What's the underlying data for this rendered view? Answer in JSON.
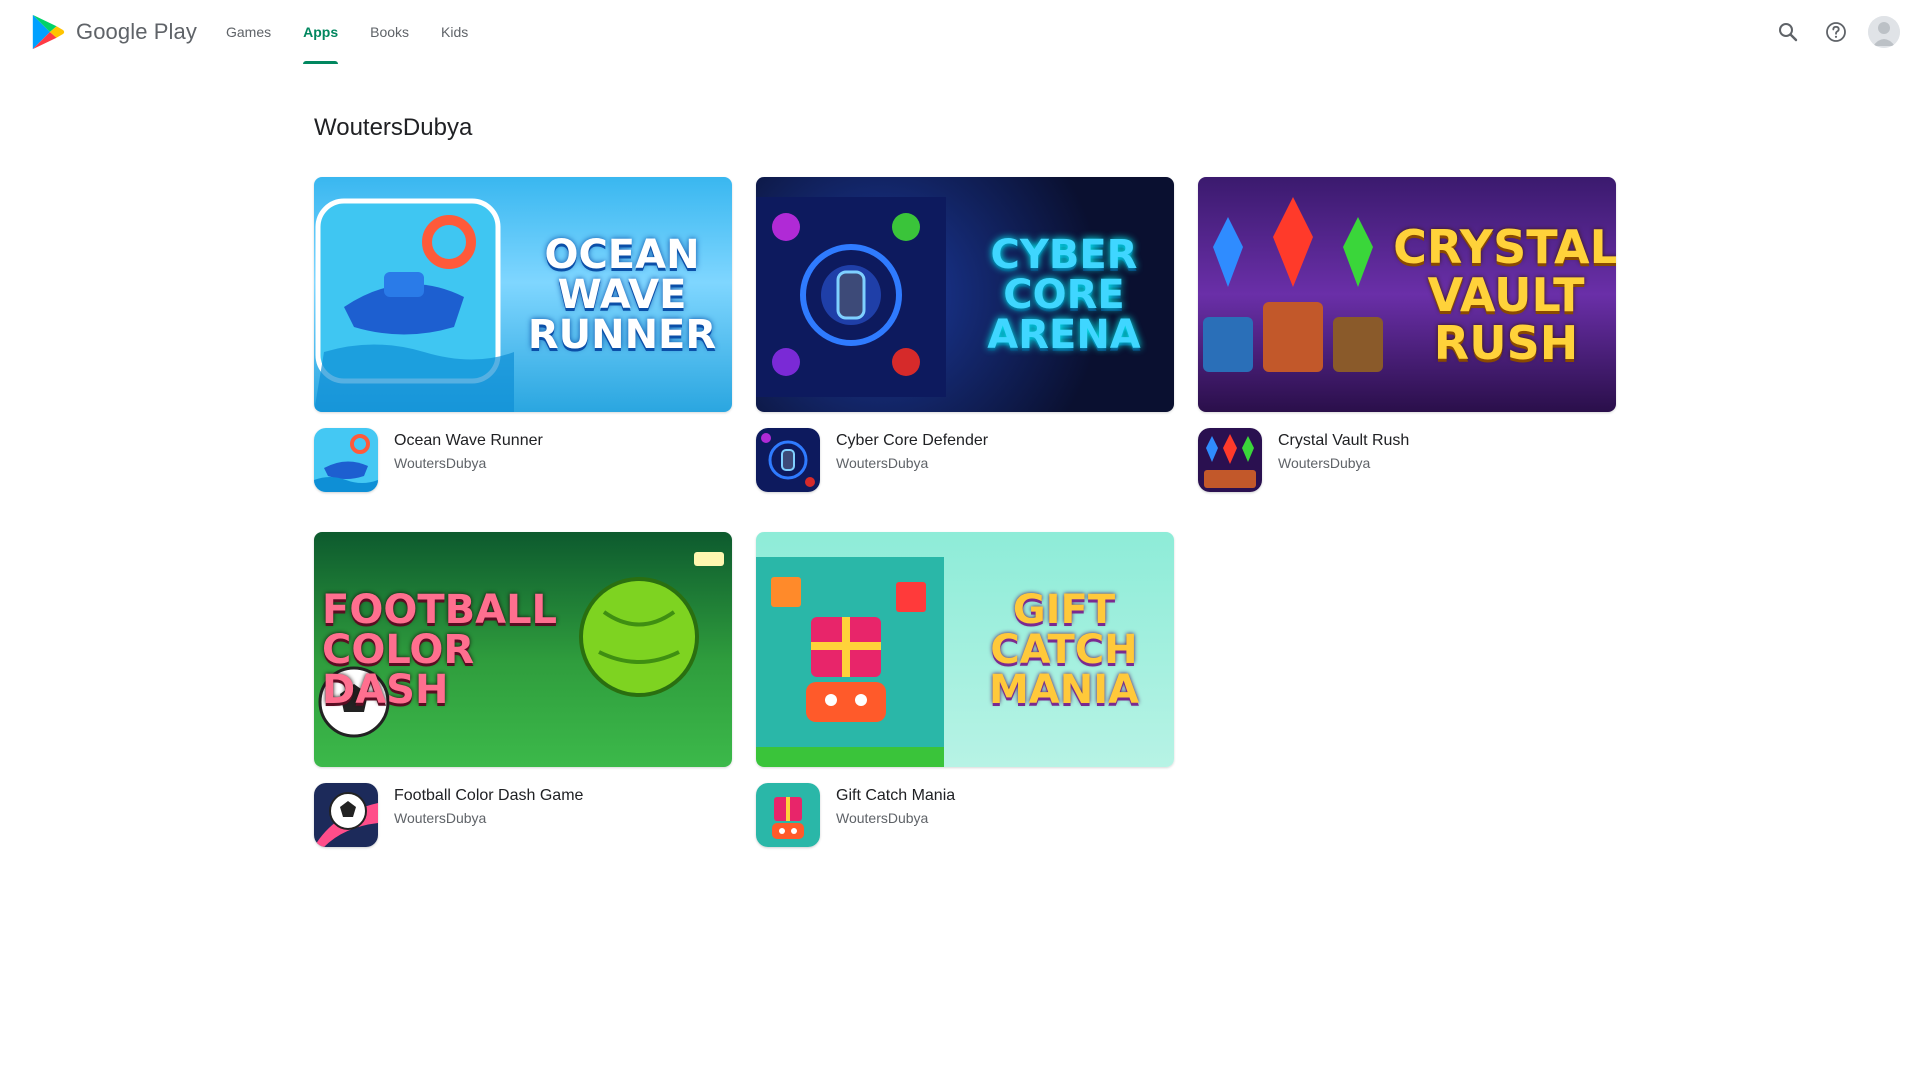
{
  "header": {
    "brand_label": "Google Play",
    "nav": [
      {
        "label": "Games",
        "active": false
      },
      {
        "label": "Apps",
        "active": true
      },
      {
        "label": "Books",
        "active": false
      },
      {
        "label": "Kids",
        "active": false
      }
    ],
    "icons": [
      "search-icon",
      "help-icon",
      "account-avatar"
    ],
    "accent_color": "#01875f"
  },
  "developer": {
    "name": "WoutersDubya"
  },
  "apps": [
    {
      "name": "Ocean Wave Runner",
      "developer": "WoutersDubya",
      "banner_title": [
        "OCEAN",
        "WAVE",
        "RUNNER"
      ]
    },
    {
      "name": "Cyber Core Defender",
      "developer": "WoutersDubya",
      "banner_title": [
        "CYBER",
        "CORE",
        "ARENA"
      ]
    },
    {
      "name": "Crystal Vault Rush",
      "developer": "WoutersDubya",
      "banner_title": [
        "CRYSTAL",
        "VAULT",
        "RUSH"
      ]
    },
    {
      "name": "Football Color Dash Game",
      "developer": "WoutersDubya",
      "banner_title": [
        "FOOTBALL",
        "COLOR",
        "DASH"
      ]
    },
    {
      "name": "Gift Catch Mania",
      "developer": "WoutersDubya",
      "banner_title": [
        "GIFT",
        "CATCH",
        "MANIA"
      ]
    }
  ]
}
